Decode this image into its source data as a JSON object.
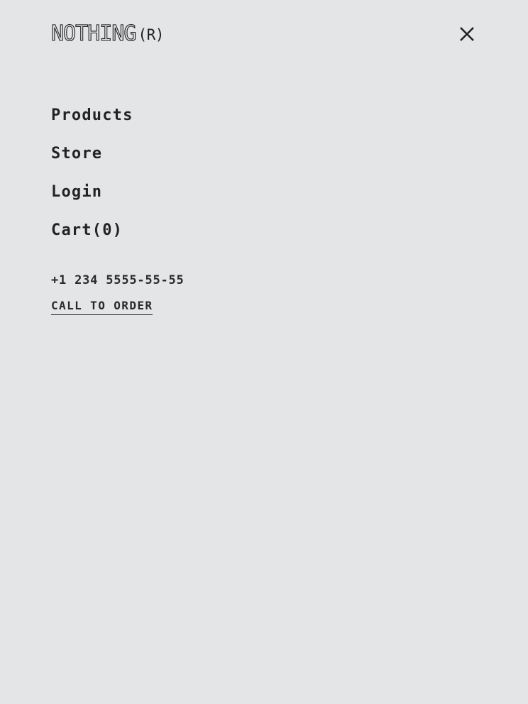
{
  "header": {
    "logo_text": "NOTHING",
    "logo_mark": "(R)",
    "close_icon": "close-icon"
  },
  "nav": {
    "items": [
      {
        "label": "Products"
      },
      {
        "label": "Store"
      },
      {
        "label": "Login"
      },
      {
        "label": "Cart(0)"
      }
    ]
  },
  "contact": {
    "phone": "+1 234 5555-55-55",
    "call_label": "CALL TO ORDER"
  },
  "colors": {
    "background": "#e4e5e7",
    "text": "#1f1f21"
  }
}
